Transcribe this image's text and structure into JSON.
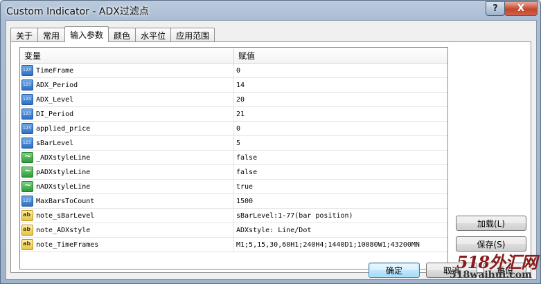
{
  "window": {
    "title": "Custom Indicator - ADX过滤点",
    "help_label": "?",
    "close_label": "X"
  },
  "tabs": [
    {
      "label": "关于"
    },
    {
      "label": "常用"
    },
    {
      "label": "输入参数",
      "active": true
    },
    {
      "label": "颜色"
    },
    {
      "label": "水平位"
    },
    {
      "label": "应用范围"
    }
  ],
  "grid": {
    "col_variable": "变量",
    "col_value": "赋值",
    "rows": [
      {
        "name": "TimeFrame",
        "value": "0",
        "icon": "number-icon"
      },
      {
        "name": "ADX_Period",
        "value": "14",
        "icon": "number-icon"
      },
      {
        "name": "ADX_Level",
        "value": "20",
        "icon": "number-icon"
      },
      {
        "name": "DI_Period",
        "value": "21",
        "icon": "number-icon"
      },
      {
        "name": "applied_price",
        "value": "0",
        "icon": "number-icon"
      },
      {
        "name": "sBarLevel",
        "value": "5",
        "icon": "number-icon"
      },
      {
        "name": "_ADXstyleLine",
        "value": "false",
        "icon": "boolean-icon"
      },
      {
        "name": "pADXstyleLine",
        "value": "false",
        "icon": "boolean-icon"
      },
      {
        "name": "nADXstyleLine",
        "value": "true",
        "icon": "boolean-icon"
      },
      {
        "name": "MaxBarsToCount",
        "value": "1500",
        "icon": "number-icon"
      },
      {
        "name": "note_sBarLevel",
        "value": "sBarLevel:1-77(bar position)",
        "icon": "string-icon"
      },
      {
        "name": "note_ADXstyle",
        "value": " ADXstyle: Line/Dot",
        "icon": "string-icon"
      },
      {
        "name": "note_TimeFrames",
        "value": "M1;5,15,30,60H1;240H4;1440D1;10080W1;43200MN",
        "icon": "string-icon"
      }
    ]
  },
  "buttons": {
    "load": "加载(L)",
    "save": "保存(S)",
    "ok": "确定",
    "cancel": "取消",
    "reset": "重设"
  },
  "watermark": {
    "line1": "518外汇网",
    "line2": "518waihui.com"
  }
}
